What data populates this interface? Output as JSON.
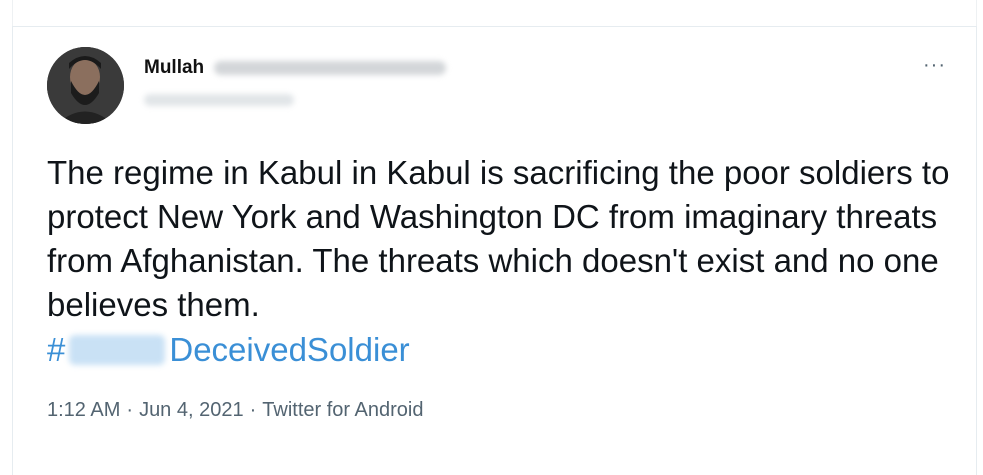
{
  "tweet": {
    "display_name": "Mullah",
    "text": "The regime in Kabul in Kabul is sacrificing the poor soldiers to protect New York and Washington DC from imaginary threats from Afghanistan. The threats which doesn't exist and no one believes them.",
    "hashtag_prefix": "#",
    "hashtag_suffix": "DeceivedSoldier",
    "more_label": "···",
    "time": "1:12 AM",
    "sep1": "·",
    "date": "Jun 4, 2021",
    "sep2": "·",
    "source": "Twitter for Android"
  },
  "colors": {
    "link": "#3a8fd6",
    "meta": "#536471",
    "text": "#0f1419"
  }
}
